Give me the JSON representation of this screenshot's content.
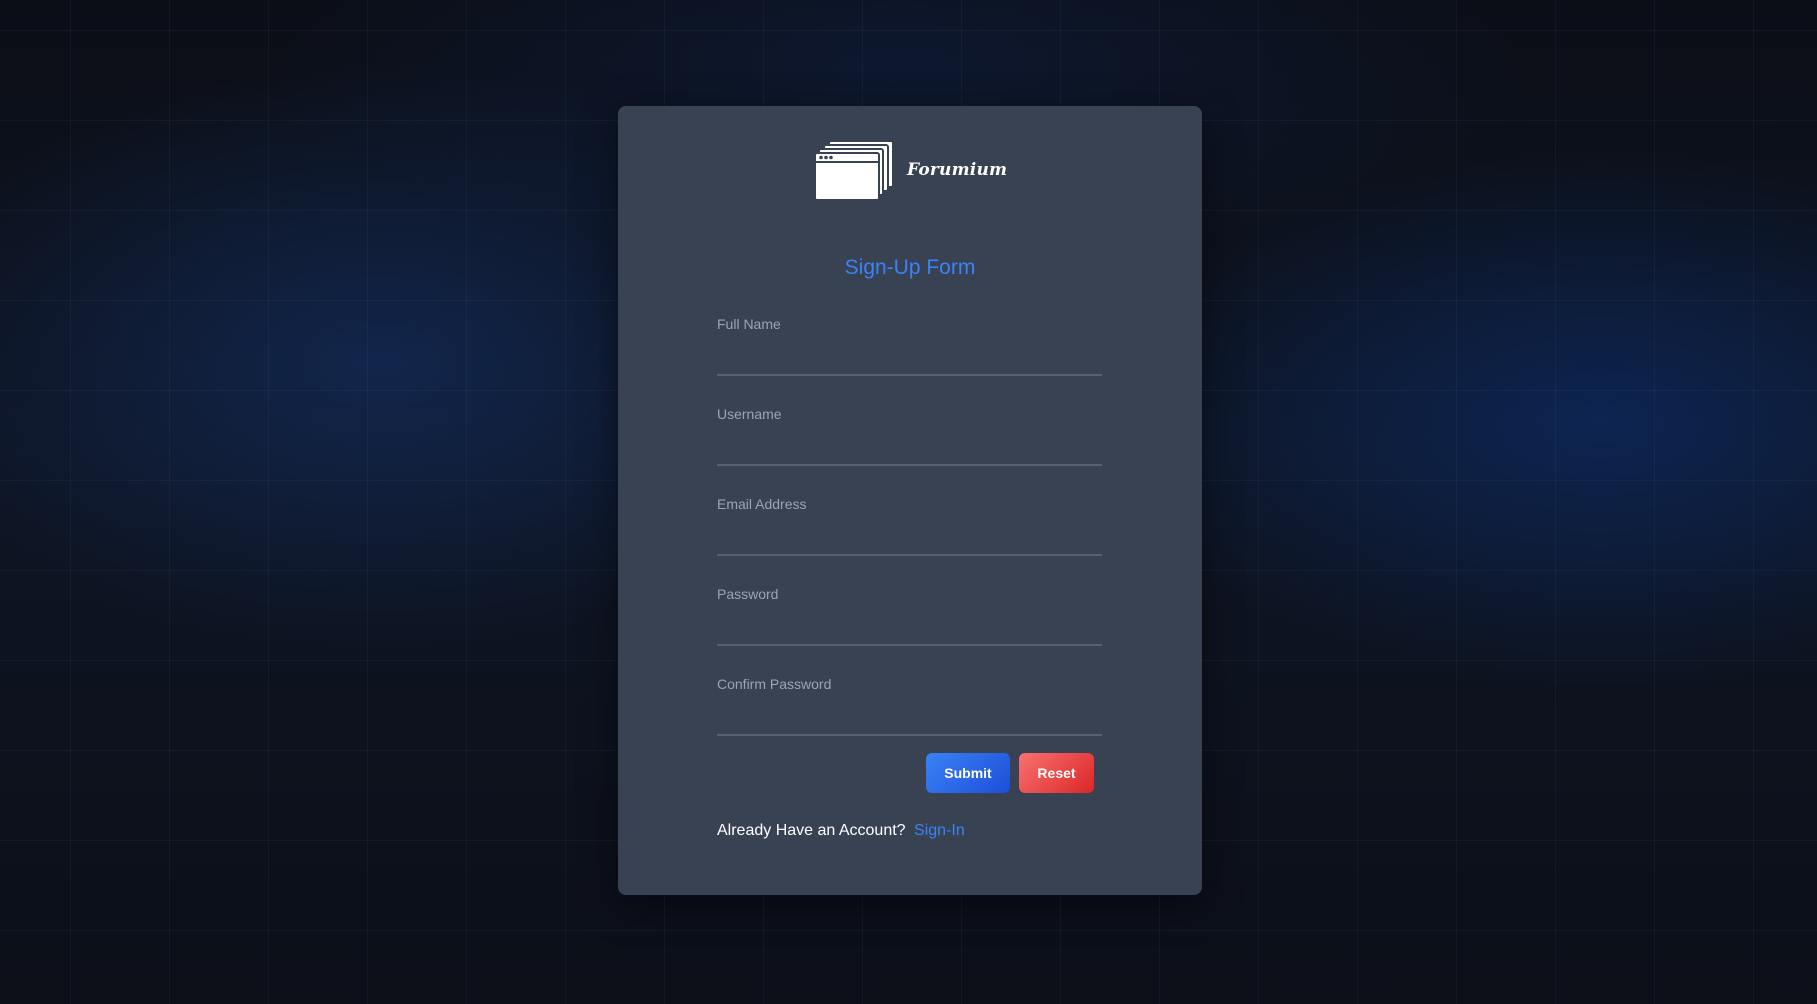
{
  "brand": {
    "name": "Forumium",
    "icon": "browser-windows-icon"
  },
  "form": {
    "title": "Sign-Up Form",
    "fields": [
      {
        "label": "Full Name",
        "value": "",
        "type": "text"
      },
      {
        "label": "Username",
        "value": "",
        "type": "text"
      },
      {
        "label": "Email Address",
        "value": "",
        "type": "email"
      },
      {
        "label": "Password",
        "value": "",
        "type": "password"
      },
      {
        "label": "Confirm Password",
        "value": "",
        "type": "password"
      }
    ],
    "submit_label": "Submit",
    "reset_label": "Reset"
  },
  "signin": {
    "prompt": "Already Have an Account?",
    "link_label": "Sign-In"
  },
  "colors": {
    "accent": "#3b82f6",
    "danger": "#ef4444",
    "card_bg": "#384253"
  }
}
